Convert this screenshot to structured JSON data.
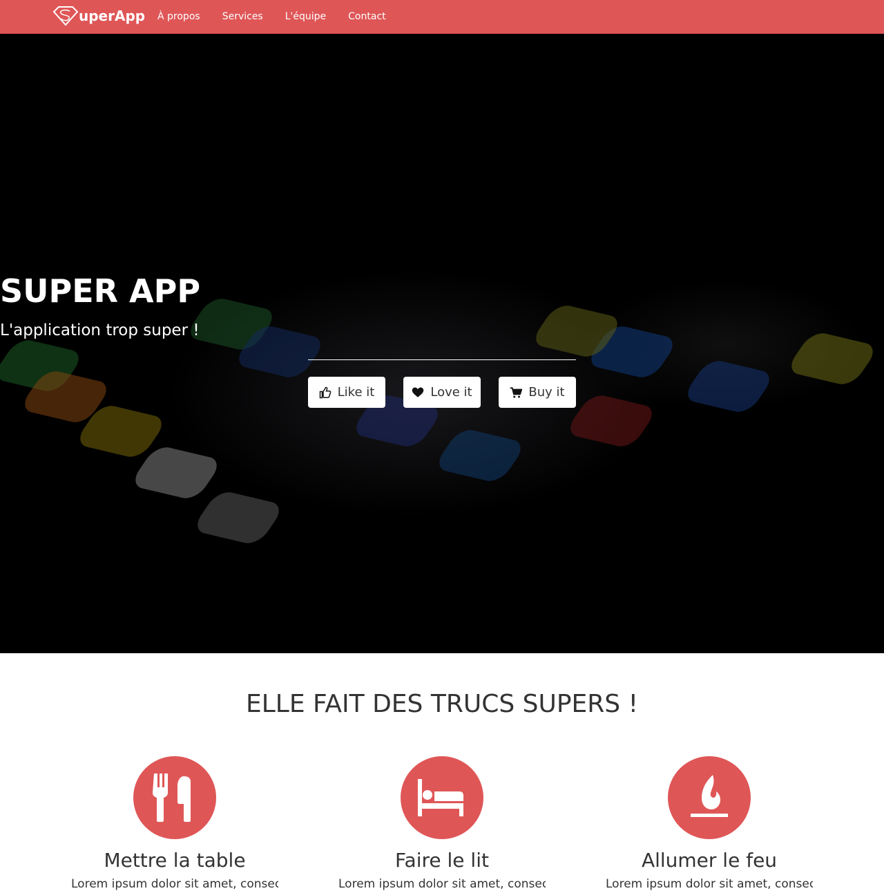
{
  "nav": {
    "brand": "uperApp",
    "brand_letter": "S",
    "links": [
      "À propos",
      "Services",
      "L'équipe",
      "Contact"
    ]
  },
  "hero": {
    "title": "SUPER APP",
    "subtitle": "L'application trop super !",
    "buttons": [
      {
        "label": "Like it",
        "icon": "thumbs-up-icon"
      },
      {
        "label": "Love it",
        "icon": "heart-icon"
      },
      {
        "label": "Buy it",
        "icon": "cart-icon"
      }
    ]
  },
  "features": {
    "title": "ELLE FAIT DES TRUCS SUPERS !",
    "items": [
      {
        "title": "Mettre la table",
        "icon": "cutlery-icon",
        "text": "Lorem ipsum dolor sit amet, consectetur"
      },
      {
        "title": "Faire le lit",
        "icon": "bed-icon",
        "text": "Lorem ipsum dolor sit amet, consectetur"
      },
      {
        "title": "Allumer le feu",
        "icon": "fire-icon",
        "text": "Lorem ipsum dolor sit amet, consectetur"
      }
    ]
  },
  "colors": {
    "accent": "#df5657"
  }
}
